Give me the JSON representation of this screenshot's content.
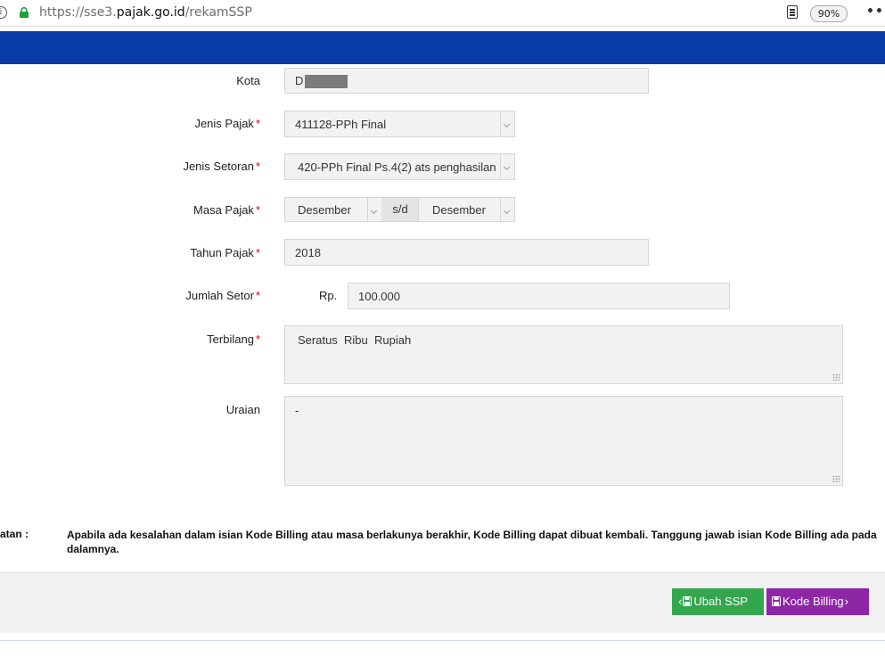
{
  "browser": {
    "url_prefix": "https://sse3.",
    "url_host": "pajak.go.id",
    "url_path": "/rekamSSP",
    "zoom": "90%",
    "more": "•••"
  },
  "form": {
    "kota": {
      "label": "Kota",
      "value": "D"
    },
    "jenis_pajak": {
      "label": "Jenis Pajak",
      "required": "*",
      "value": "411128-PPh Final"
    },
    "jenis_setoran": {
      "label": "Jenis Setoran",
      "required": "*",
      "value": "420-PPh Final Ps.4(2) ats penghasilan"
    },
    "masa_pajak": {
      "label": "Masa Pajak",
      "required": "*",
      "from": "Desember",
      "separator": "s/d",
      "to": "Desember"
    },
    "tahun_pajak": {
      "label": "Tahun Pajak",
      "required": "*",
      "value": "2018"
    },
    "jumlah_setor": {
      "label": "Jumlah Setor",
      "required": "*",
      "currency": "Rp.",
      "value": "100.000"
    },
    "terbilang": {
      "label": "Terbilang",
      "required": "*",
      "value": "Seratus  Ribu  Rupiah"
    },
    "uraian": {
      "label": "Uraian",
      "value": "-"
    }
  },
  "catatan": {
    "label": "tatan :",
    "text": "Apabila ada kesalahan dalam isian Kode Billing atau masa berlakunya berakhir, Kode Billing dapat dibuat kembali. Tanggung jawab isian Kode Billing ada pada dalamnya."
  },
  "actions": {
    "ubah_ssp": "Ubah SSP",
    "kode_billing": "Kode Billing"
  },
  "colors": {
    "header_blue": "#0a3ca7",
    "btn_green": "#33a64e",
    "btn_purple": "#8e27a6",
    "required_red": "#d9000c"
  }
}
